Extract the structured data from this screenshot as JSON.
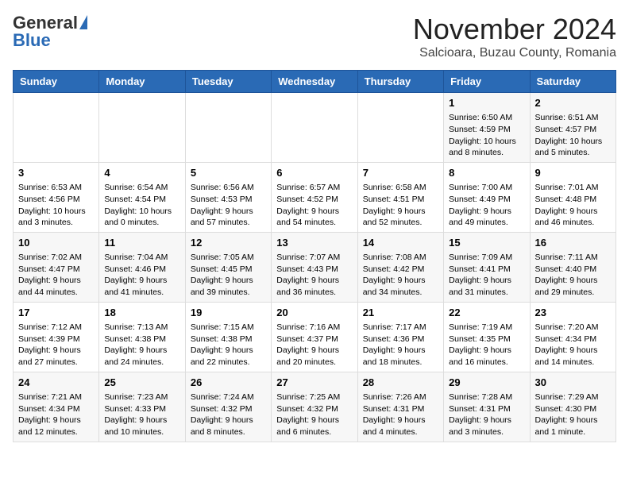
{
  "logo": {
    "general": "General",
    "blue": "Blue"
  },
  "header": {
    "month": "November 2024",
    "location": "Salcioara, Buzau County, Romania"
  },
  "days": [
    "Sunday",
    "Monday",
    "Tuesday",
    "Wednesday",
    "Thursday",
    "Friday",
    "Saturday"
  ],
  "weeks": [
    [
      {
        "day": "",
        "content": ""
      },
      {
        "day": "",
        "content": ""
      },
      {
        "day": "",
        "content": ""
      },
      {
        "day": "",
        "content": ""
      },
      {
        "day": "",
        "content": ""
      },
      {
        "day": "1",
        "content": "Sunrise: 6:50 AM\nSunset: 4:59 PM\nDaylight: 10 hours and 8 minutes."
      },
      {
        "day": "2",
        "content": "Sunrise: 6:51 AM\nSunset: 4:57 PM\nDaylight: 10 hours and 5 minutes."
      }
    ],
    [
      {
        "day": "3",
        "content": "Sunrise: 6:53 AM\nSunset: 4:56 PM\nDaylight: 10 hours and 3 minutes."
      },
      {
        "day": "4",
        "content": "Sunrise: 6:54 AM\nSunset: 4:54 PM\nDaylight: 10 hours and 0 minutes."
      },
      {
        "day": "5",
        "content": "Sunrise: 6:56 AM\nSunset: 4:53 PM\nDaylight: 9 hours and 57 minutes."
      },
      {
        "day": "6",
        "content": "Sunrise: 6:57 AM\nSunset: 4:52 PM\nDaylight: 9 hours and 54 minutes."
      },
      {
        "day": "7",
        "content": "Sunrise: 6:58 AM\nSunset: 4:51 PM\nDaylight: 9 hours and 52 minutes."
      },
      {
        "day": "8",
        "content": "Sunrise: 7:00 AM\nSunset: 4:49 PM\nDaylight: 9 hours and 49 minutes."
      },
      {
        "day": "9",
        "content": "Sunrise: 7:01 AM\nSunset: 4:48 PM\nDaylight: 9 hours and 46 minutes."
      }
    ],
    [
      {
        "day": "10",
        "content": "Sunrise: 7:02 AM\nSunset: 4:47 PM\nDaylight: 9 hours and 44 minutes."
      },
      {
        "day": "11",
        "content": "Sunrise: 7:04 AM\nSunset: 4:46 PM\nDaylight: 9 hours and 41 minutes."
      },
      {
        "day": "12",
        "content": "Sunrise: 7:05 AM\nSunset: 4:45 PM\nDaylight: 9 hours and 39 minutes."
      },
      {
        "day": "13",
        "content": "Sunrise: 7:07 AM\nSunset: 4:43 PM\nDaylight: 9 hours and 36 minutes."
      },
      {
        "day": "14",
        "content": "Sunrise: 7:08 AM\nSunset: 4:42 PM\nDaylight: 9 hours and 34 minutes."
      },
      {
        "day": "15",
        "content": "Sunrise: 7:09 AM\nSunset: 4:41 PM\nDaylight: 9 hours and 31 minutes."
      },
      {
        "day": "16",
        "content": "Sunrise: 7:11 AM\nSunset: 4:40 PM\nDaylight: 9 hours and 29 minutes."
      }
    ],
    [
      {
        "day": "17",
        "content": "Sunrise: 7:12 AM\nSunset: 4:39 PM\nDaylight: 9 hours and 27 minutes."
      },
      {
        "day": "18",
        "content": "Sunrise: 7:13 AM\nSunset: 4:38 PM\nDaylight: 9 hours and 24 minutes."
      },
      {
        "day": "19",
        "content": "Sunrise: 7:15 AM\nSunset: 4:38 PM\nDaylight: 9 hours and 22 minutes."
      },
      {
        "day": "20",
        "content": "Sunrise: 7:16 AM\nSunset: 4:37 PM\nDaylight: 9 hours and 20 minutes."
      },
      {
        "day": "21",
        "content": "Sunrise: 7:17 AM\nSunset: 4:36 PM\nDaylight: 9 hours and 18 minutes."
      },
      {
        "day": "22",
        "content": "Sunrise: 7:19 AM\nSunset: 4:35 PM\nDaylight: 9 hours and 16 minutes."
      },
      {
        "day": "23",
        "content": "Sunrise: 7:20 AM\nSunset: 4:34 PM\nDaylight: 9 hours and 14 minutes."
      }
    ],
    [
      {
        "day": "24",
        "content": "Sunrise: 7:21 AM\nSunset: 4:34 PM\nDaylight: 9 hours and 12 minutes."
      },
      {
        "day": "25",
        "content": "Sunrise: 7:23 AM\nSunset: 4:33 PM\nDaylight: 9 hours and 10 minutes."
      },
      {
        "day": "26",
        "content": "Sunrise: 7:24 AM\nSunset: 4:32 PM\nDaylight: 9 hours and 8 minutes."
      },
      {
        "day": "27",
        "content": "Sunrise: 7:25 AM\nSunset: 4:32 PM\nDaylight: 9 hours and 6 minutes."
      },
      {
        "day": "28",
        "content": "Sunrise: 7:26 AM\nSunset: 4:31 PM\nDaylight: 9 hours and 4 minutes."
      },
      {
        "day": "29",
        "content": "Sunrise: 7:28 AM\nSunset: 4:31 PM\nDaylight: 9 hours and 3 minutes."
      },
      {
        "day": "30",
        "content": "Sunrise: 7:29 AM\nSunset: 4:30 PM\nDaylight: 9 hours and 1 minute."
      }
    ]
  ]
}
